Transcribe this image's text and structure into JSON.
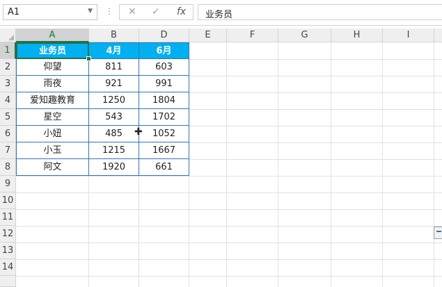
{
  "formula_bar": {
    "name_box": "A1",
    "cancel_glyph": "✕",
    "enter_glyph": "✓",
    "fx_glyph": "fx",
    "content": "业务员"
  },
  "columns": [
    "A",
    "B",
    "D",
    "E",
    "F",
    "G",
    "H",
    "I"
  ],
  "rows": [
    "1",
    "2",
    "3",
    "4",
    "5",
    "6",
    "7",
    "8",
    "9",
    "10",
    "11",
    "12",
    "13",
    "14"
  ],
  "table": {
    "headers": [
      "业务员",
      "4月",
      "6月"
    ],
    "rows": [
      [
        "仰望",
        "811",
        "603"
      ],
      [
        "雨夜",
        "921",
        "991"
      ],
      [
        "爱知趣教育",
        "1250",
        "1804"
      ],
      [
        "星空",
        "543",
        "1702"
      ],
      [
        "小妞",
        "485",
        "1052"
      ],
      [
        "小玉",
        "1215",
        "1667"
      ],
      [
        "阿文",
        "1920",
        "661"
      ]
    ]
  },
  "colors": {
    "header_fill": "#00b0f0",
    "table_border": "#2e75b6",
    "selection": "#217346"
  },
  "icons": {
    "namebox_dropdown": "chevron-down-icon",
    "cursor": "cell-select-cursor-icon",
    "quick_analysis": "quick-analysis-icon"
  }
}
